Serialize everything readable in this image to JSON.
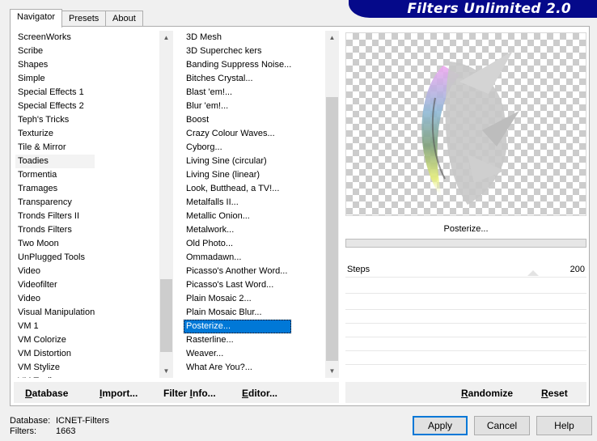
{
  "brand": {
    "title": "Filters Unlimited 2.0"
  },
  "tabs": [
    "Navigator",
    "Presets",
    "About"
  ],
  "categories": [
    "ScreenWorks",
    "Scribe",
    "Shapes",
    "Simple",
    "Special Effects 1",
    "Special Effects 2",
    "Teph's Tricks",
    "Texturize",
    "Tile & Mirror",
    "Toadies",
    "Tormentia",
    "Tramages",
    "Transparency",
    "Tronds Filters II",
    "Tronds Filters",
    "Two Moon",
    "UnPlugged Tools",
    "Video",
    "Videofilter",
    "Video",
    "Visual Manipulation",
    "VM 1",
    "VM Colorize",
    "VM Distortion",
    "VM Stylize",
    "VM Toolbox"
  ],
  "selected_category": "Toadies",
  "filters": [
    "3D Mesh",
    "3D Superchec kers",
    "Banding Suppress Noise...",
    "Bitches Crystal...",
    "Blast 'em!...",
    "Blur 'em!...",
    "Boost",
    "Crazy Colour Waves...",
    "Cyborg...",
    "Living Sine (circular)",
    "Living Sine (linear)",
    "Look, Butthead, a TV!...",
    "Metalfalls II...",
    "Metallic Onion...",
    "Metalwork...",
    "Old Photo...",
    "Ommadawn...",
    "Picasso's Another Word...",
    "Picasso's Last Word...",
    "Plain Mosaic 2...",
    "Plain Mosaic Blur...",
    "Posterize...",
    "Rasterline...",
    "Weaver...",
    "What Are You?..."
  ],
  "selected_filter": "Posterize...",
  "preview": {
    "filter_name": "Posterize..."
  },
  "params": [
    {
      "label": "Steps",
      "value": "200",
      "level": 200
    }
  ],
  "toolbar_left": [
    {
      "label": "Database",
      "ul": "D",
      "rest": "atabase"
    },
    {
      "label": "Import...",
      "ul": "I",
      "rest": "mport..."
    },
    {
      "label": "Filter Info...",
      "pre": "Filter ",
      "ul": "I",
      "rest": "nfo..."
    },
    {
      "label": "Editor...",
      "ul": "E",
      "rest": "ditor..."
    }
  ],
  "toolbar_right": [
    {
      "label": "Randomize",
      "ul": "R",
      "rest": "andomize"
    },
    {
      "label": "Reset",
      "ul": "R",
      "rest": "eset"
    }
  ],
  "info": {
    "database_label": "Database:",
    "database_value": "ICNET-Filters",
    "filters_label": "Filters:",
    "filters_value": "1663"
  },
  "buttons": {
    "apply": "Apply",
    "cancel": "Cancel",
    "help": "Help"
  },
  "colors": {
    "brand_bg": "#05098a",
    "selection": "#0078d7"
  }
}
